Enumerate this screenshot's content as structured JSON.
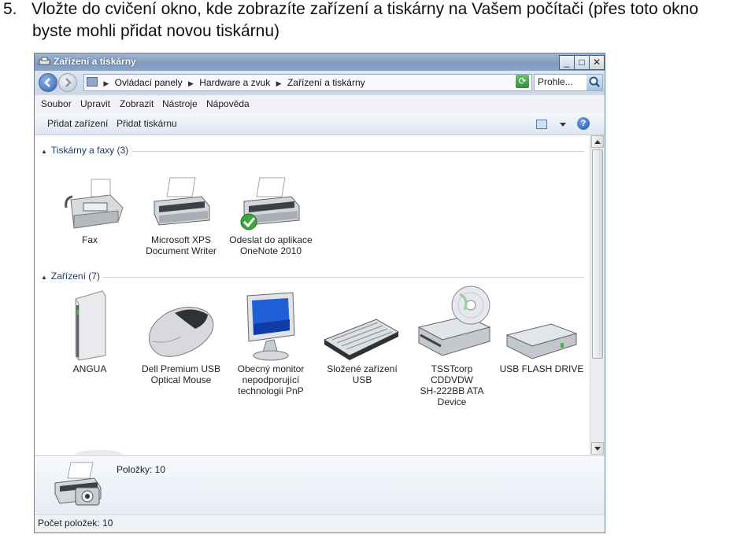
{
  "instruction": {
    "number": "5.",
    "line1": "Vložte do cvičení okno, kde zobrazíte zařízení a tiskárny na Vašem počítači (přes toto okno",
    "line2": "byste mohli přidat novou tiskárnu)"
  },
  "window": {
    "title": "Zařízení a tiskárny",
    "buttons": {
      "minimize": "_",
      "maximize": "□",
      "close": "✕"
    }
  },
  "address_bar": {
    "crumbs": [
      "Ovládací panely",
      "Hardware a zvuk",
      "Zařízení a tiskárny"
    ],
    "search_value": "Prohle..."
  },
  "menu": [
    "Soubor",
    "Upravit",
    "Zobrazit",
    "Nástroje",
    "Nápověda"
  ],
  "toolbar": {
    "add_device": "Přidat zařízení",
    "add_printer": "Přidat tiskárnu",
    "help": "?"
  },
  "groups": {
    "printers": {
      "title": "Tiskárny a faxy (3)",
      "items": [
        {
          "label1": "Fax",
          "label2": "",
          "icon": "fax-icon"
        },
        {
          "label1": "Microsoft XPS",
          "label2": "Document Writer",
          "icon": "printer-icon"
        },
        {
          "label1": "Odeslat do aplikace",
          "label2": "OneNote 2010",
          "icon": "printer-default-icon"
        }
      ]
    },
    "devices": {
      "title": "Zařízení (7)",
      "items": [
        {
          "label1": "ANGUA",
          "label2": "",
          "label3": "",
          "label4": "",
          "icon": "computer-tower-icon"
        },
        {
          "label1": "Dell Premium USB",
          "label2": "Optical Mouse",
          "label3": "",
          "label4": "",
          "icon": "mouse-icon"
        },
        {
          "label1": "Obecný monitor",
          "label2": "nepodporující",
          "label3": "technologii PnP",
          "label4": "",
          "icon": "monitor-icon"
        },
        {
          "label1": "Složené zařízení",
          "label2": "USB",
          "label3": "",
          "label4": "",
          "icon": "keyboard-icon"
        },
        {
          "label1": "TSSTcorp",
          "label2": "CDDVDW",
          "label3": "SH-222BB ATA",
          "label4": "Device",
          "icon": "dvd-drive-icon"
        },
        {
          "label1": "USB FLASH DRIVE",
          "label2": "",
          "label3": "",
          "label4": "",
          "icon": "usb-drive-icon"
        }
      ]
    }
  },
  "details_pane": {
    "count_text": "Položky: 10"
  },
  "status_bar": {
    "text": "Počet položek: 10"
  }
}
